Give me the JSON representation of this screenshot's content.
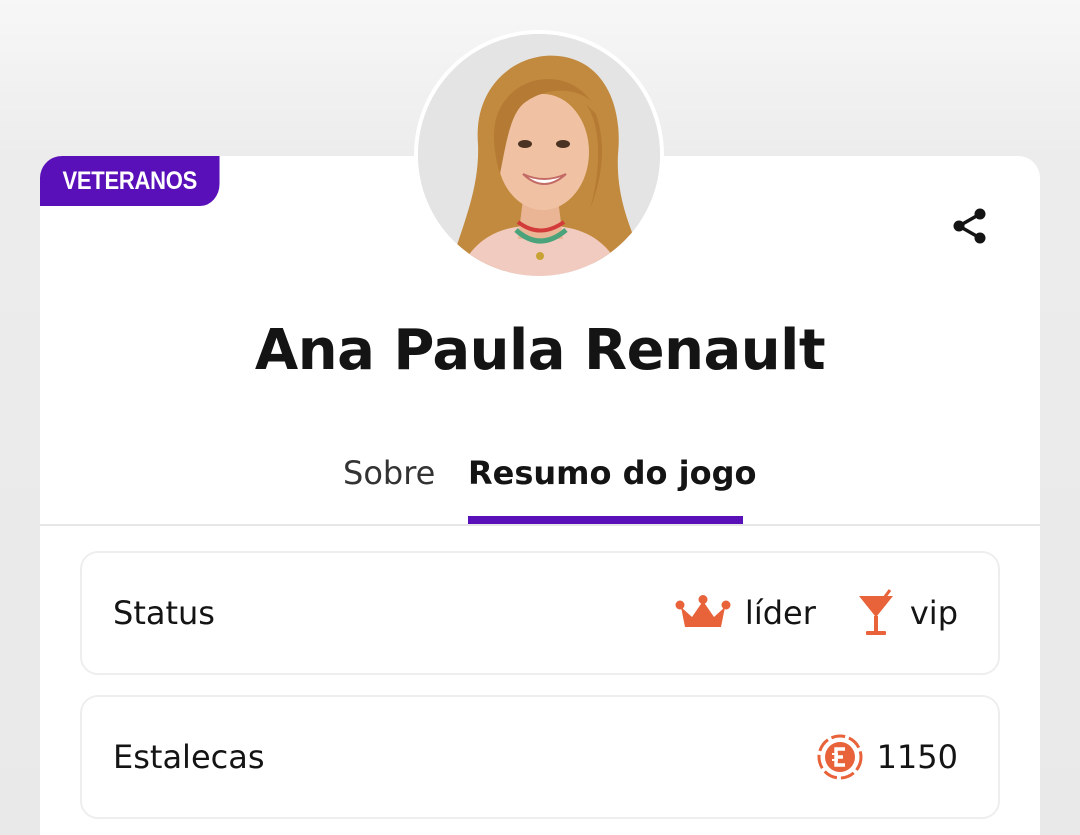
{
  "badge": {
    "label": "VETERANOS"
  },
  "profile": {
    "name": "Ana Paula Renault"
  },
  "tabs": [
    {
      "label": "Sobre",
      "active": false
    },
    {
      "label": "Resumo do jogo",
      "active": true
    }
  ],
  "summary": {
    "status": {
      "label": "Status",
      "items": [
        {
          "icon": "crown-icon",
          "text": "líder"
        },
        {
          "icon": "cocktail-icon",
          "text": "vip"
        }
      ]
    },
    "estalecas": {
      "label": "Estalecas",
      "icon": "estaleca-coin-icon",
      "value": "1150"
    }
  },
  "colors": {
    "accent": "#5a10b9",
    "icon": "#e8623a",
    "text": "#141414"
  }
}
